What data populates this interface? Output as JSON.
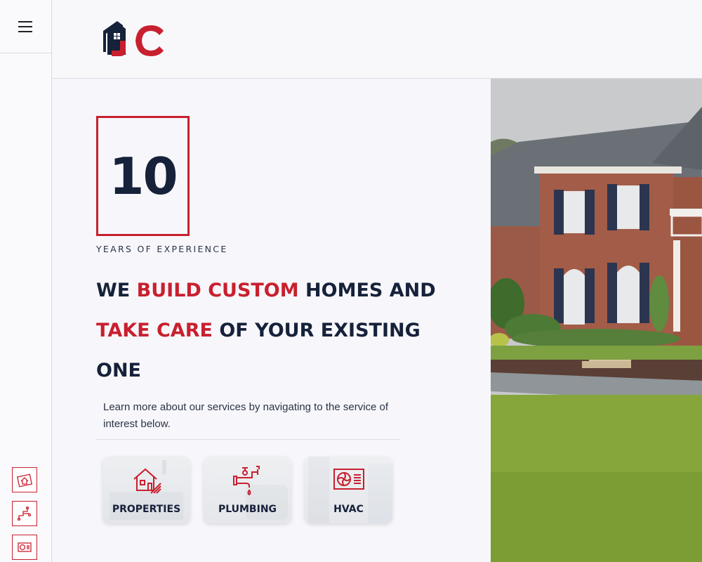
{
  "menu": {
    "icon": "hamburger-menu-icon"
  },
  "sidebar": {
    "quick_links": [
      {
        "name": "properties-shortcut",
        "icon": "blueprint-house-icon"
      },
      {
        "name": "plumbing-shortcut",
        "icon": "pipe-icon"
      },
      {
        "name": "hvac-shortcut",
        "icon": "hvac-unit-icon"
      }
    ]
  },
  "header": {
    "logo_text": "JC",
    "logo_icon": "house-logo-icon"
  },
  "experience": {
    "number": "10",
    "label": "YEARS OF EXPERIENCE"
  },
  "headline": {
    "part1": "WE ",
    "part2": "BUILD CUSTOM",
    "part3": " HOMES AND ",
    "part4": "TAKE CARE",
    "part5": " OF YOUR EXISTING ONE"
  },
  "description": "Learn more about our services by navigating to the service of interest below.",
  "services": [
    {
      "label": "PROPERTIES",
      "icon": "house-blueprint-icon"
    },
    {
      "label": "PLUMBING",
      "icon": "faucet-pipe-icon"
    },
    {
      "label": "HVAC",
      "icon": "air-conditioner-icon"
    }
  ],
  "hero": {
    "image": "brick-house-photo"
  },
  "colors": {
    "brand_red": "#c8202f",
    "brand_navy": "#16213a"
  }
}
